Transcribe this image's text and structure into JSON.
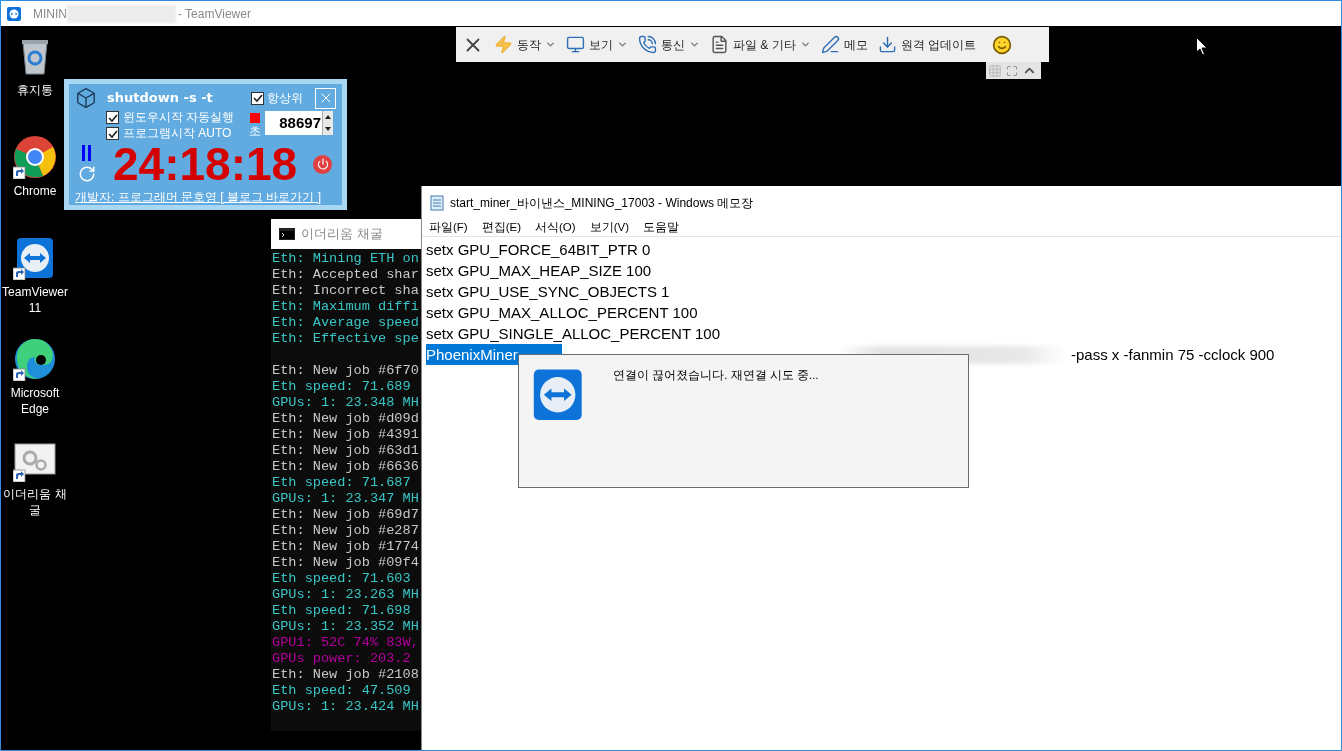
{
  "window": {
    "title_start": "MININ",
    "title_end": "- TeamViewer"
  },
  "desktop_icons": [
    {
      "label": "휴지통",
      "kind": "recycle-bin",
      "shortcut": false
    },
    {
      "label": "Chrome",
      "kind": "globe",
      "shortcut": true
    },
    {
      "label": "TeamViewer 11",
      "kind": "remote",
      "shortcut": true
    },
    {
      "label": "Microsoft Edge",
      "kind": "wave",
      "shortcut": true
    },
    {
      "label": "이더리움 채굴",
      "kind": "program",
      "shortcut": true
    }
  ],
  "timer_widget": {
    "command": "shutdown -s -t",
    "options": [
      {
        "label": "항상위",
        "checked": true
      },
      {
        "label": "윈도우시작 자동실행",
        "checked": true
      },
      {
        "label": "프로그램시작 AUTO",
        "checked": true
      }
    ],
    "unit": "초",
    "seconds": "88697",
    "countdown": "24:18:18",
    "credit_link": "개발자: 프로그래머 문호영 [ 블로그 바로가기 ]"
  },
  "toolbar": {
    "items": [
      {
        "label": "동작",
        "dropdown": true
      },
      {
        "label": "보기",
        "dropdown": true
      },
      {
        "label": "통신",
        "dropdown": true
      },
      {
        "label": "파일 & 기타",
        "dropdown": true
      },
      {
        "label": "메모",
        "dropdown": false
      },
      {
        "label": "원격 업데이트",
        "dropdown": false
      }
    ]
  },
  "console": {
    "title": "이더리움 채굴",
    "blocks": [
      [
        {
          "text": "Eth: Mining ETH on",
          "color": "#3ac6c6"
        },
        {
          "text": "Eth: Accepted shar",
          "color": "#c8c8c8"
        },
        {
          "text": "Eth: Incorrect sha",
          "color": "#c8c8c8"
        },
        {
          "text": "Eth: Maximum diffi",
          "color": "#3ac6c6"
        },
        {
          "text": "Eth: Average speed",
          "color": "#3ac6c6"
        },
        {
          "text": "Eth: Effective spe",
          "color": "#3ac6c6"
        }
      ],
      [
        {
          "text": "Eth: New job #6f70",
          "color": "#c8c8c8"
        },
        {
          "text": "Eth speed: 71.689",
          "color": "#3ac6c6"
        },
        {
          "text": "GPUs: 1: 23.348 MH",
          "color": "#3ac6c6"
        },
        {
          "text": "Eth: New job #d09d",
          "color": "#c8c8c8"
        },
        {
          "text": "Eth: New job #4391",
          "color": "#c8c8c8"
        },
        {
          "text": "Eth: New job #63d1",
          "color": "#c8c8c8"
        },
        {
          "text": "Eth: New job #6636",
          "color": "#c8c8c8"
        },
        {
          "text": "Eth speed: 71.687",
          "color": "#3ac6c6"
        },
        {
          "text": "GPUs: 1: 23.347 MH",
          "color": "#3ac6c6"
        },
        {
          "text": "Eth: New job #69d7",
          "color": "#c8c8c8"
        },
        {
          "text": "Eth: New job #e287",
          "color": "#c8c8c8"
        },
        {
          "text": "Eth: New job #1774",
          "color": "#c8c8c8"
        },
        {
          "text": "Eth: New job #09f4",
          "color": "#c8c8c8"
        },
        {
          "text": "Eth speed: 71.603",
          "color": "#3ac6c6"
        },
        {
          "text": "GPUs: 1: 23.263 MH",
          "color": "#3ac6c6"
        },
        {
          "text": "Eth speed: 71.698",
          "color": "#3ac6c6"
        },
        {
          "text": "GPUs: 1: 23.352 MH",
          "color": "#3ac6c6"
        },
        {
          "text": "GPU1: 52C 74% 83W,",
          "color": "#b4009e"
        },
        {
          "text": "GPUs power: 203.2",
          "color": "#b4009e"
        },
        {
          "text": "Eth: New job #2108",
          "color": "#c8c8c8"
        },
        {
          "text": "Eth speed: 47.509",
          "color": "#3ac6c6"
        },
        {
          "text": "GPUs: 1: 23.424 MH",
          "color": "#3ac6c6"
        }
      ]
    ]
  },
  "notepad": {
    "title": "start_miner_바이낸스_MINING_17003 - Windows 메모장",
    "menu": [
      "파일(F)",
      "편집(E)",
      "서식(O)",
      "보기(V)",
      "도움말"
    ],
    "lines": [
      [
        {
          "kind": "text",
          "text": "setx GPU_FORCE_64BIT_PTR 0"
        }
      ],
      [
        {
          "kind": "text",
          "text": "setx GPU_MAX_HEAP_SIZE 100"
        }
      ],
      [
        {
          "kind": "text",
          "text": "setx GPU_USE_SYNC_OBJECTS 1"
        }
      ],
      [
        {
          "kind": "text",
          "text": "setx GPU_MAX_ALLOC_PERCENT 100"
        }
      ],
      [
        {
          "kind": "text",
          "text": "setx GPU_SINGLE_ALLOC_PERCENT 100"
        }
      ],
      [
        {
          "kind": "selection",
          "text": "PhoenixMiner"
        },
        {
          "kind": "redacted"
        },
        {
          "kind": "text",
          "text": "-pass x -fanmin 75 -cclock 900"
        }
      ]
    ]
  },
  "dialog": {
    "message": "연결이 끊어졌습니다. 재연결 시도 중..."
  }
}
